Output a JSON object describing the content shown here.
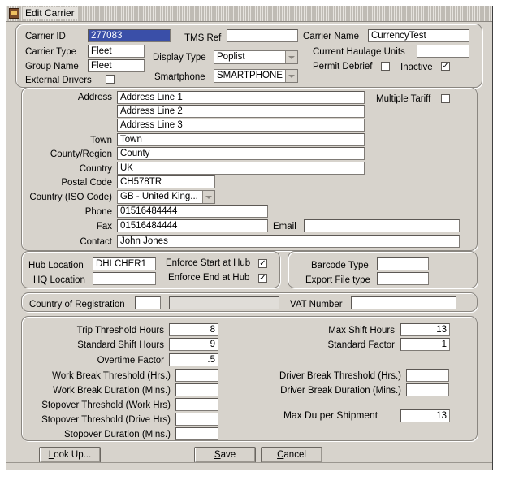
{
  "window": {
    "title": "Edit Carrier"
  },
  "header": {
    "carrier_id_label": "Carrier ID",
    "carrier_id": "277083",
    "tms_ref_label": "TMS Ref",
    "tms_ref": "",
    "carrier_name_label": "Carrier Name",
    "carrier_name": "CurrencyTest",
    "carrier_type_label": "Carrier Type",
    "carrier_type": "Fleet",
    "display_type_label": "Display Type",
    "display_type": "Poplist",
    "current_haulage_units_label": "Current Haulage Units",
    "current_haulage_units": "",
    "group_name_label": "Group Name",
    "group_name": "Fleet",
    "permit_debrief_label": "Permit Debrief",
    "permit_debrief_checked": false,
    "inactive_label": "Inactive",
    "inactive_checked": true,
    "external_drivers_label": "External Drivers",
    "external_drivers_checked": false,
    "smartphone_label": "Smartphone",
    "smartphone": "SMARTPHONE"
  },
  "address": {
    "address_label": "Address",
    "line1": "Address Line 1",
    "line2": "Address Line 2",
    "line3": "Address Line 3",
    "multiple_tariff_label": "Multiple Tariff",
    "multiple_tariff_checked": false,
    "town_label": "Town",
    "town": "Town",
    "county_label": "County/Region",
    "county": "County",
    "country_label": "Country",
    "country": "UK",
    "postal_code_label": "Postal Code",
    "postal_code": "CH578TR",
    "country_iso_label": "Country (ISO Code)",
    "country_iso": "GB - United King...",
    "phone_label": "Phone",
    "phone": "01516484444",
    "fax_label": "Fax",
    "fax": "01516484444",
    "email_label": "Email",
    "email": "",
    "contact_label": "Contact",
    "contact": "John Jones"
  },
  "hub": {
    "hub_location_label": "Hub Location",
    "hub_location": "DHLCHER1",
    "hq_location_label": "HQ Location",
    "hq_location": "",
    "enforce_start_label": "Enforce Start at Hub",
    "enforce_start_checked": true,
    "enforce_end_label": "Enforce End at Hub",
    "enforce_end_checked": true,
    "barcode_type_label": "Barcode Type",
    "barcode_type": "",
    "export_file_type_label": "Export File type",
    "export_file_type": ""
  },
  "registration": {
    "country_of_registration_label": "Country of Registration",
    "country_code": "",
    "country_desc": "",
    "vat_number_label": "VAT Number",
    "vat_number": ""
  },
  "hours": {
    "trip_threshold_label": "Trip Threshold Hours",
    "trip_threshold": "8",
    "standard_shift_label": "Standard Shift Hours",
    "standard_shift": "9",
    "overtime_factor_label": "Overtime Factor",
    "overtime_factor": ".5",
    "work_break_threshold_label": "Work Break Threshold (Hrs.)",
    "work_break_threshold": "",
    "work_break_duration_label": "Work Break Duration (Mins.)",
    "work_break_duration": "",
    "stopover_threshold_work_label": "Stopover Threshold (Work Hrs)",
    "stopover_threshold_work": "",
    "stopover_threshold_drive_label": "Stopover Threshold (Drive Hrs)",
    "stopover_threshold_drive": "",
    "stopover_duration_label": "Stopover Duration (Mins.)",
    "stopover_duration": "",
    "max_shift_label": "Max Shift Hours",
    "max_shift": "13",
    "standard_factor_label": "Standard Factor",
    "standard_factor": "1",
    "driver_break_threshold_label": "Driver Break Threshold (Hrs.)",
    "driver_break_threshold": "",
    "driver_break_duration_label": "Driver Break Duration (Mins.)",
    "driver_break_duration": "",
    "max_du_label": "Max Du per Shipment",
    "max_du": "13"
  },
  "buttons": {
    "lookup_prefix": "L",
    "lookup_rest": "ook Up...",
    "save_prefix": "S",
    "save_rest": "ave",
    "cancel_prefix": "C",
    "cancel_rest": "ancel"
  },
  "checkmark_glyph": "✓"
}
